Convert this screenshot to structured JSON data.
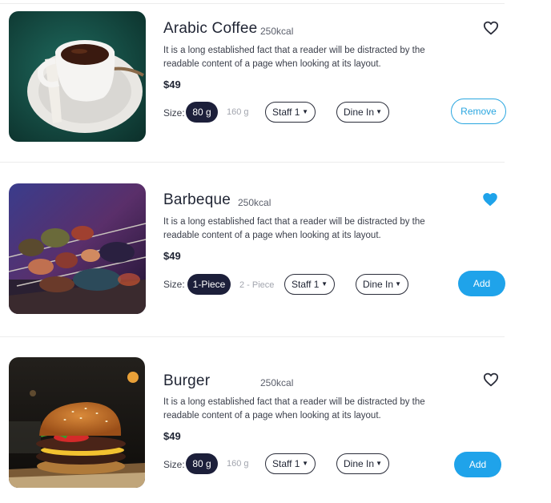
{
  "items": [
    {
      "title": "Arabic Coffee",
      "kcal": "250kcal",
      "description_line1": "It is a long established fact that a reader will be distracted by the",
      "description_line2": "readable content of a page when looking at its layout.",
      "price": "$49",
      "size_label": "Size:",
      "size_selected": "80 g",
      "size_alt": "160 g",
      "staff": "Staff 1",
      "dining": "Dine In",
      "action": "Remove",
      "favorited": false,
      "image": "coffee-cup-photo"
    },
    {
      "title": "Barbeque",
      "kcal": "250kcal",
      "description_line1": "It is a long established fact that a reader will be distracted by the",
      "description_line2": "readable content of a page when looking at its layout.",
      "price": "$49",
      "size_label": "Size:",
      "size_selected": "1-Piece",
      "size_alt": "2 - Piece",
      "staff": "Staff 1",
      "dining": "Dine In",
      "action": "Add",
      "favorited": true,
      "image": "barbeque-skewers-photo"
    },
    {
      "title": "Burger",
      "kcal": "250kcal",
      "description_line1": "It is a long established fact that a reader will be distracted by the",
      "description_line2": "readable content of a page when looking at its layout.",
      "price": "$49",
      "size_label": "Size:",
      "size_selected": "80 g",
      "size_alt": "160 g",
      "staff": "Staff 1",
      "dining": "Dine In",
      "action": "Add",
      "favorited": false,
      "image": "burger-photo"
    }
  ],
  "icons": {
    "favorite": "heart-icon",
    "dropdown": "chevron-down-icon"
  },
  "colors": {
    "accent": "#1fa3ea",
    "selected_pill": "#1c1f3a",
    "text": "#1f2433"
  }
}
